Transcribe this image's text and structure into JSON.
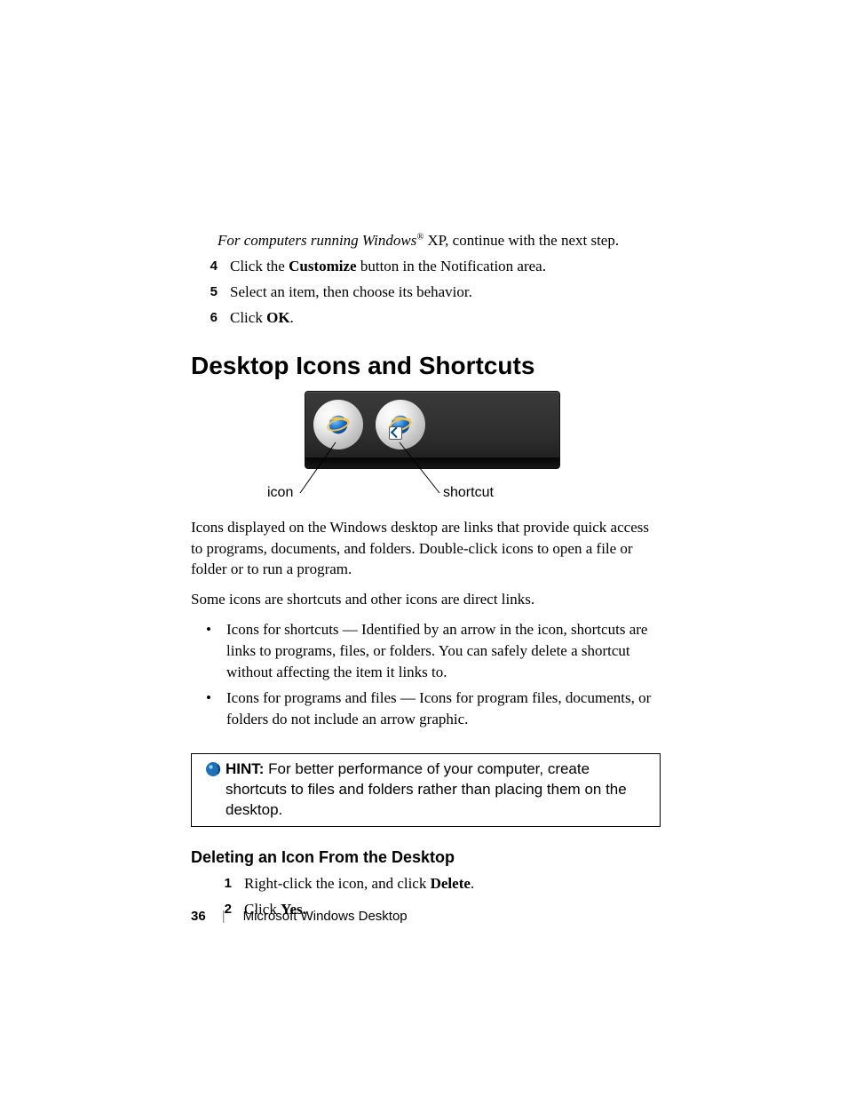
{
  "intro": {
    "prefix_italic": "For computers running Windows",
    "reg": "®",
    "suffix": " XP, continue with the next step."
  },
  "top_steps": [
    {
      "n": "4",
      "before": "Click the ",
      "bold": "Customize",
      "after": " button in the Notification area."
    },
    {
      "n": "5",
      "before": "Select an item, then choose its behavior.",
      "bold": "",
      "after": ""
    },
    {
      "n": "6",
      "before": "Click ",
      "bold": "OK",
      "after": "."
    }
  ],
  "heading": "Desktop Icons and Shortcuts",
  "figure": {
    "label_left": "icon",
    "label_right": "shortcut"
  },
  "para1": "Icons displayed on the Windows desktop are links that provide quick access to programs, documents, and folders. Double-click icons to open a file or folder or to run a program.",
  "para2": "Some icons are shortcuts and other icons are direct links.",
  "bullets": [
    "Icons for shortcuts — Identified by an arrow in the icon, shortcuts are links to programs, files, or folders. You can safely delete a shortcut without affecting the item it links to.",
    "Icons for programs and files — Icons for program files, documents, or folders do not include an arrow graphic."
  ],
  "hint": {
    "label": "HINT:",
    "text": " For better performance of your computer, create shortcuts to files and folders rather than placing them on the desktop."
  },
  "subheading": "Deleting an Icon From the Desktop",
  "del_steps": [
    {
      "n": "1",
      "before": "Right-click the icon, and click ",
      "bold": "Delete",
      "after": "."
    },
    {
      "n": "2",
      "before": "Click ",
      "bold": "Yes.",
      "after": ""
    }
  ],
  "footer": {
    "page": "36",
    "title": "Microsoft Windows Desktop"
  }
}
